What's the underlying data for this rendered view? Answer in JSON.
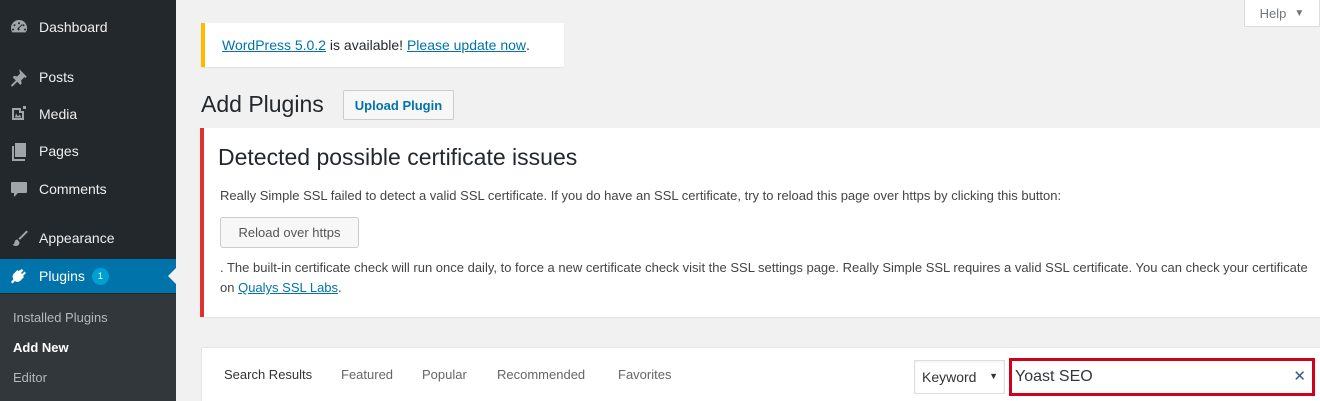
{
  "sidebar": {
    "items": [
      {
        "label": "Dashboard",
        "icon": "dashboard-icon"
      },
      {
        "label": "Posts",
        "icon": "pushpin-icon"
      },
      {
        "label": "Media",
        "icon": "media-icon"
      },
      {
        "label": "Pages",
        "icon": "pages-icon"
      },
      {
        "label": "Comments",
        "icon": "comment-icon"
      },
      {
        "label": "Appearance",
        "icon": "paintbrush-icon"
      },
      {
        "label": "Plugins",
        "icon": "plugin-icon",
        "badge": "1"
      }
    ],
    "submenu": [
      {
        "label": "Installed Plugins"
      },
      {
        "label": "Add New"
      },
      {
        "label": "Editor"
      }
    ]
  },
  "help": {
    "label": "Help"
  },
  "update_nag": {
    "link1": "WordPress 5.0.2",
    "middle": " is available! ",
    "link2": "Please update now",
    "end": "."
  },
  "page": {
    "title": "Add Plugins",
    "upload_label": "Upload Plugin"
  },
  "ssl_notice": {
    "title": "Detected possible certificate issues",
    "description": "Really Simple SSL failed to detect a valid SSL certificate. If you do have an SSL certificate, try to reload this page over https by clicking this button:",
    "reload_label": "Reload over https",
    "footer_text": ". The built-in certificate check will run once daily, to force a new certificate check visit the SSL settings page. Really Simple SSL requires a valid SSL certificate. You can check your certificate on ",
    "footer_link": "Qualys SSL Labs",
    "footer_end": "."
  },
  "filter": {
    "tabs": [
      "Search Results",
      "Featured",
      "Popular",
      "Recommended",
      "Favorites"
    ],
    "search_type": "Keyword",
    "search_value": "Yoast SEO"
  },
  "colors": {
    "sidebar_bg": "#23282d",
    "active_bg": "#0073aa",
    "link": "#0073aa",
    "warning_border": "#ffba00",
    "error_border": "#dc3232",
    "highlight_border": "#d0021b"
  }
}
